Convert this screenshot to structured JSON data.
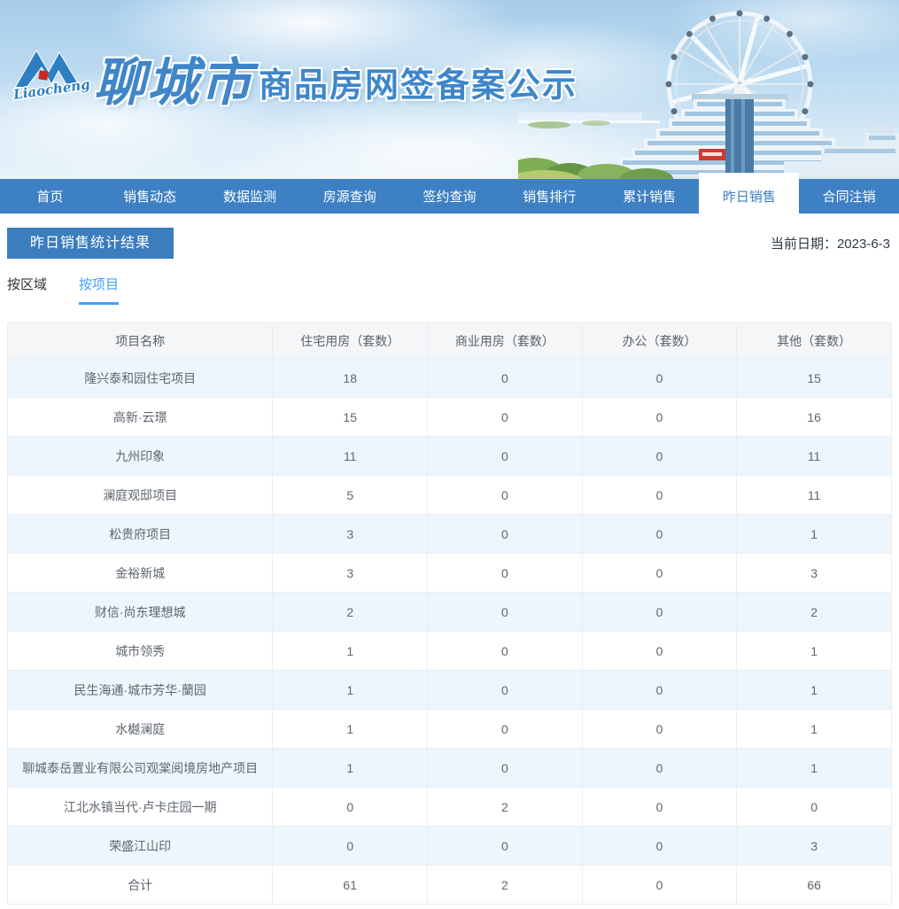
{
  "banner": {
    "logo_script": "Liaocheng",
    "city_script": "聊城市",
    "site_title": "商品房网签备案公示"
  },
  "nav": {
    "items": [
      {
        "label": "首页"
      },
      {
        "label": "销售动态"
      },
      {
        "label": "数据监测"
      },
      {
        "label": "房源查询"
      },
      {
        "label": "签约查询"
      },
      {
        "label": "销售排行"
      },
      {
        "label": "累计销售"
      },
      {
        "label": "昨日销售",
        "active": true
      },
      {
        "label": "合同注销"
      }
    ]
  },
  "page": {
    "section_title": "昨日销售统计结果",
    "date_label": "当前日期：",
    "date_value": "2023-6-3"
  },
  "tabs": [
    {
      "label": "按区域",
      "active": false
    },
    {
      "label": "按项目",
      "active": true
    }
  ],
  "table": {
    "headers": [
      "项目名称",
      "住宅用房（套数）",
      "商业用房（套数）",
      "办公（套数）",
      "其他（套数）"
    ],
    "rows": [
      {
        "name": "隆兴泰和园住宅项目",
        "values": [
          18,
          0,
          0,
          15
        ]
      },
      {
        "name": "高新·云璟",
        "values": [
          15,
          0,
          0,
          16
        ]
      },
      {
        "name": "九州印象",
        "values": [
          11,
          0,
          0,
          11
        ]
      },
      {
        "name": "澜庭观邸项目",
        "values": [
          5,
          0,
          0,
          11
        ]
      },
      {
        "name": "松贵府项目",
        "values": [
          3,
          0,
          0,
          1
        ]
      },
      {
        "name": "金裕新城",
        "values": [
          3,
          0,
          0,
          3
        ]
      },
      {
        "name": "财信·尚东理想城",
        "values": [
          2,
          0,
          0,
          2
        ]
      },
      {
        "name": "城市领秀",
        "values": [
          1,
          0,
          0,
          1
        ]
      },
      {
        "name": "民生海通·城市芳华·蘭园",
        "values": [
          1,
          0,
          0,
          1
        ]
      },
      {
        "name": "水樾澜庭",
        "values": [
          1,
          0,
          0,
          1
        ]
      },
      {
        "name": "聊城泰岳置业有限公司观棠阅境房地产项目",
        "values": [
          1,
          0,
          0,
          1
        ]
      },
      {
        "name": "江北水镇当代·卢卡庄园一期",
        "values": [
          0,
          2,
          0,
          0
        ]
      },
      {
        "name": "荣盛江山印",
        "values": [
          0,
          0,
          0,
          3
        ]
      },
      {
        "name": "合计",
        "values": [
          61,
          2,
          0,
          66
        ]
      }
    ]
  },
  "colors": {
    "nav_blue": "#3d80c4",
    "badge_blue": "#3b7dbd",
    "tab_active_blue": "#409eff",
    "stripe_blue": "#edf6fd",
    "table_header_bg": "#f4f6f8",
    "table_border": "#e9eef3",
    "brand_blue": "#3f86c9",
    "logo_red": "#c8281e"
  }
}
